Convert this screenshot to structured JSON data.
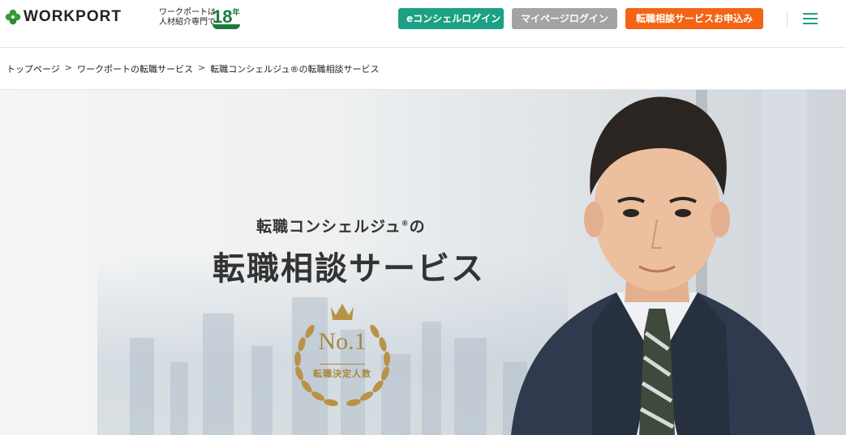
{
  "header": {
    "logo_text": "WORKPORT",
    "tagline_line1": "ワークポートは",
    "tagline_line2": "人材紹介専門で",
    "tagline_years": "18",
    "tagline_years_unit": "年",
    "econ_login": "eコンシェルログイン",
    "mypage_login": "マイページログイン",
    "apply_button": "転職相談サービスお申込み"
  },
  "breadcrumb": {
    "items": [
      "トップページ",
      "ワークポートの転職サービス",
      "転職コンシェルジュ®の転職相談サービス"
    ],
    "separator": ">"
  },
  "hero": {
    "subtitle_main": "転職コンシェルジュ",
    "subtitle_reg": "®",
    "subtitle_tail": "の",
    "title": "転職相談サービス",
    "badge_rank": "No.1",
    "badge_label": "転職決定人数"
  },
  "colors": {
    "econ": "#1ca184",
    "mypage": "#a3a3a3",
    "apply": "#f36414",
    "brand_green": "#1a7a3c",
    "gold": "#a9863e"
  }
}
